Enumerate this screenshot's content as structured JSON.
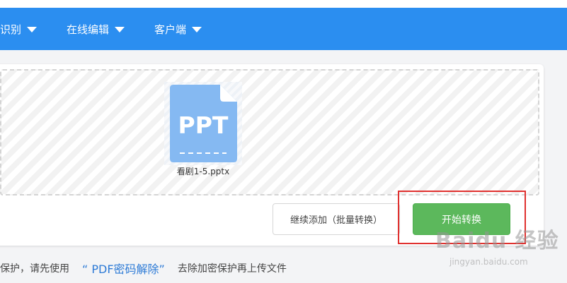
{
  "nav": {
    "items": [
      {
        "label": "识别"
      },
      {
        "label": "在线编辑"
      },
      {
        "label": "客户端"
      }
    ]
  },
  "upload": {
    "file_type_text": "PPT",
    "file_name": "看剧1-5.pptx",
    "add_button": "继续添加（批量转换）",
    "start_button": "开始转换"
  },
  "hint": {
    "prefix": "保护，请先使用",
    "link": "“ PDF密码解除”",
    "suffix": "去除加密保护再上传文件"
  },
  "watermark": {
    "logo": "Baidu 经验",
    "url": "jingyan.baidu.com"
  },
  "colors": {
    "navbar": "#2b8ef0",
    "file_icon": "#85b9f2",
    "start_button": "#5cb85c",
    "highlight": "#e0312f",
    "link": "#2e7bd6"
  }
}
